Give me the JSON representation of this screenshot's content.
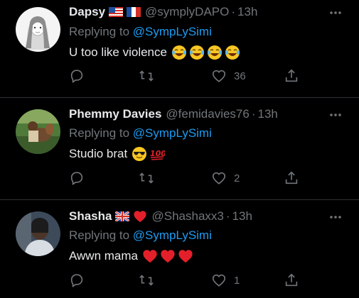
{
  "colors": {
    "background": "#000000",
    "text": "#e7e9ea",
    "muted": "#71767b",
    "link": "#1d9bf0",
    "divider": "#2f3336"
  },
  "replies": [
    {
      "name": "Dapsy",
      "handle": "@symplyDAPO",
      "time": "13h",
      "replying_prefix": "Replying to ",
      "mention": "@SympLySimi",
      "text": "U too like violence",
      "name_emojis": [
        "flag-us-icon",
        "flag-france-icon"
      ],
      "text_emojis": [
        "tears-of-joy-emoji",
        "tears-of-joy-emoji",
        "tears-of-joy-emoji",
        "tears-of-joy-emoji"
      ],
      "likes": "36"
    },
    {
      "name": "Phemmy Davies",
      "handle": "@femidavies76",
      "time": "13h",
      "replying_prefix": "Replying to ",
      "mention": "@SympLySimi",
      "text": "Studio brat",
      "name_emojis": [],
      "text_emojis": [
        "sunglasses-face-emoji",
        "hundred-points-emoji"
      ],
      "likes": "2"
    },
    {
      "name": "Shasha",
      "handle": "@Shashaxx3",
      "time": "13h",
      "replying_prefix": "Replying to ",
      "mention": "@SympLySimi",
      "text": "Awwn mama",
      "name_emojis": [
        "flag-uk-icon",
        "red-heart-emoji"
      ],
      "text_emojis": [
        "red-heart-emoji",
        "red-heart-emoji",
        "red-heart-emoji"
      ],
      "likes": "1"
    }
  ],
  "separator": "·"
}
